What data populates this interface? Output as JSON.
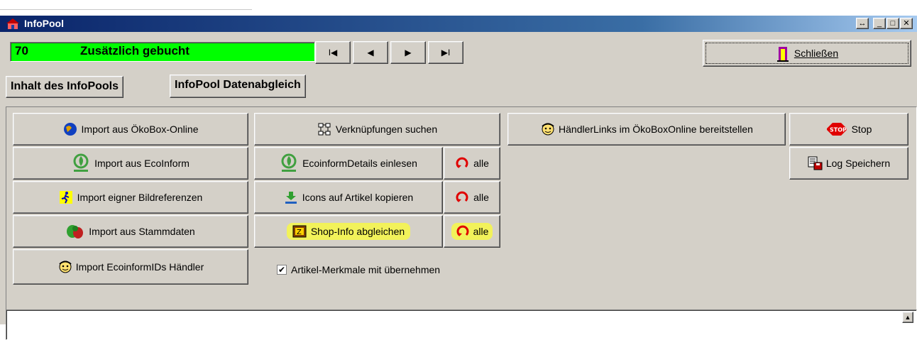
{
  "window": {
    "title": "InfoPool"
  },
  "status": {
    "number": "70",
    "text": "Zusätzlich gebucht"
  },
  "nav": {
    "first": "I◀",
    "prev": "◀",
    "next": "▶",
    "last": "▶I"
  },
  "close_button": {
    "label": "Schließen"
  },
  "tabs": [
    {
      "label": "Inhalt des InfoPools"
    },
    {
      "label": "InfoPool Datenabgleich"
    }
  ],
  "buttons": {
    "import_oekobox": "Import aus ÖkoBox-Online",
    "import_ecoinform": "Import aus EcoInform",
    "import_bildreferenzen": "Import eigner Bildreferenzen",
    "import_stammdaten": "Import aus Stammdaten",
    "import_ecoinformids": "Import EcoinformIDs Händler",
    "verknuepfungen": "Verknüpfungen suchen",
    "ecoinform_details": "EcoinformDetails einlesen",
    "icons_kopieren": "Icons auf Artikel kopieren",
    "shop_info": "Shop-Info abgleichen",
    "alle": "alle",
    "haendlerlinks": "HändlerLinks im ÖkoBoxOnline bereitstellen",
    "stop": "Stop",
    "log_speichern": "Log Speichern"
  },
  "checkbox": {
    "label": "Artikel-Merkmale mit übernehmen",
    "checked": true
  },
  "colors": {
    "status_bg": "#00ff00",
    "highlight": "#f2f25a",
    "title_bar": "#0a246a"
  }
}
